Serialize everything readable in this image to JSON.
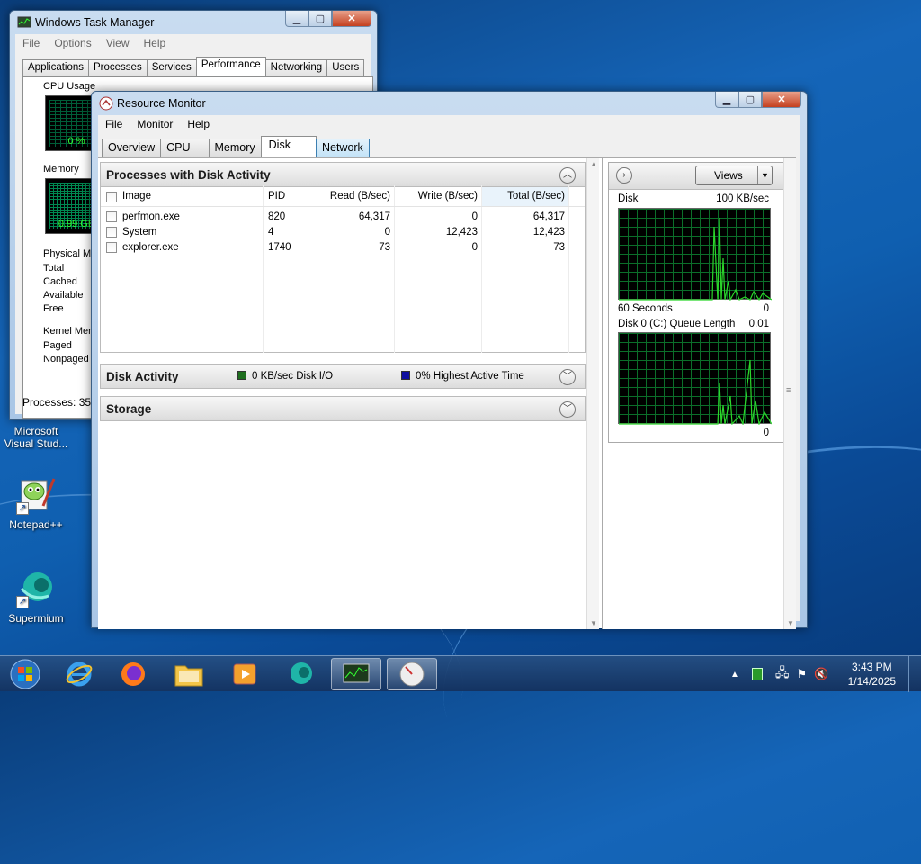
{
  "desktop": {
    "icons": [
      {
        "label": "Microsoft Visual Stud..."
      },
      {
        "label": "Notepad++"
      },
      {
        "label": "Supermium"
      }
    ]
  },
  "taskmgr": {
    "title": "Windows Task Manager",
    "menu": [
      "File",
      "Options",
      "View",
      "Help"
    ],
    "tabs": [
      "Applications",
      "Processes",
      "Services",
      "Performance",
      "Networking",
      "Users"
    ],
    "active_tab": "Performance",
    "cpu_usage_label": "CPU Usage",
    "cpu_value": "0 %",
    "memory_label": "Memory",
    "memory_value": "0.99 GB",
    "physical_label": "Physical Me",
    "physical_rows": [
      "Total",
      "Cached",
      "Available",
      "Free"
    ],
    "kernel_label": "Kernel Mem",
    "kernel_rows": [
      "Paged",
      "Nonpaged"
    ],
    "status": "Processes: 35"
  },
  "resmon": {
    "title": "Resource Monitor",
    "menu": [
      "File",
      "Monitor",
      "Help"
    ],
    "tabs": [
      "Overview",
      "CPU",
      "Memory",
      "Disk",
      "Network"
    ],
    "active_tab": "Disk",
    "processes_section": {
      "title": "Processes with Disk Activity",
      "columns": [
        "Image",
        "PID",
        "Read (B/sec)",
        "Write (B/sec)",
        "Total (B/sec)"
      ],
      "rows": [
        {
          "image": "perfmon.exe",
          "pid": "820",
          "read": "64,317",
          "write": "0",
          "total": "64,317"
        },
        {
          "image": "System",
          "pid": "4",
          "read": "0",
          "write": "12,423",
          "total": "12,423"
        },
        {
          "image": "explorer.exe",
          "pid": "1740",
          "read": "73",
          "write": "0",
          "total": "73"
        }
      ]
    },
    "disk_activity": {
      "title": "Disk Activity",
      "io_text": "0 KB/sec Disk I/O",
      "io_color": "#1e6e1e",
      "active_text": "0% Highest Active Time",
      "active_color": "#1010a0"
    },
    "storage": {
      "title": "Storage"
    },
    "right": {
      "views_label": "Views",
      "disk_graph": {
        "title": "Disk",
        "max": "100 KB/sec",
        "footer_left": "60 Seconds",
        "footer_right": "0"
      },
      "queue_graph": {
        "title": "Disk 0 (C:) Queue Length",
        "max": "0.01",
        "footer_right": "0"
      }
    }
  },
  "taskbar": {
    "time": "3:43 PM",
    "date": "1/14/2025"
  },
  "colors": {
    "graph_green": "#2bd62b",
    "selected_tab": "#ffffff"
  }
}
